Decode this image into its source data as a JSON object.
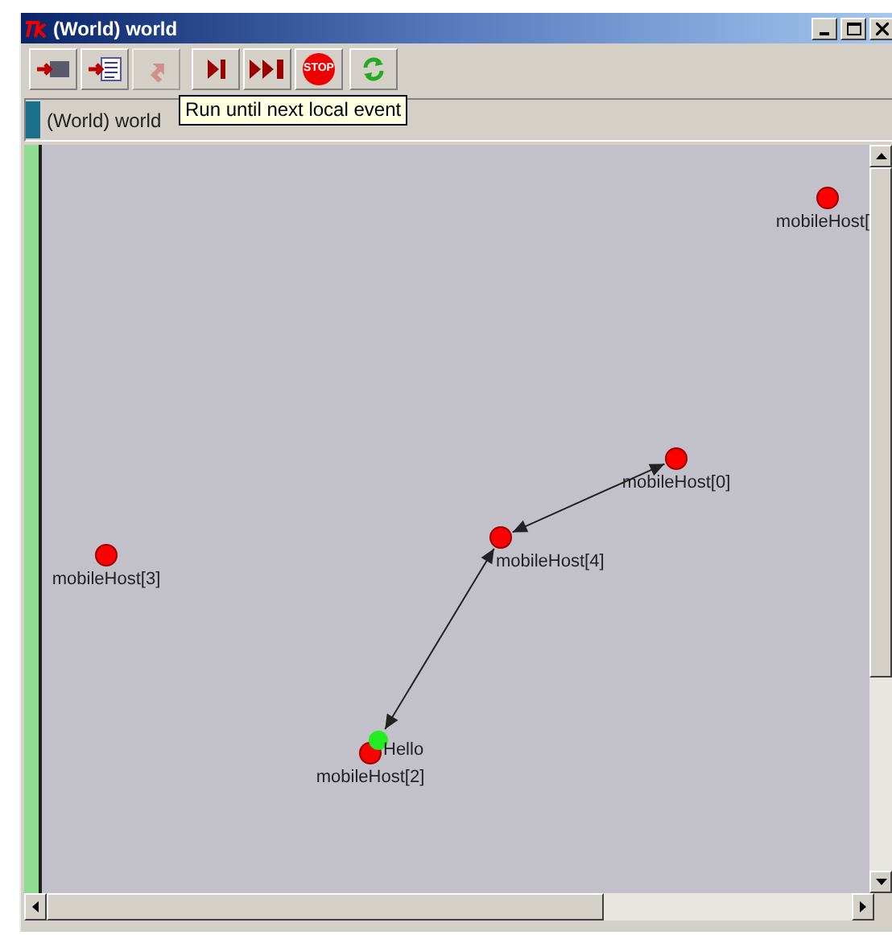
{
  "window": {
    "title": "(World) world"
  },
  "toolbar": [
    {
      "kind": "step-into",
      "disabled": false
    },
    {
      "kind": "step-list",
      "disabled": false
    },
    {
      "kind": "up",
      "disabled": true
    },
    {
      "kind": "step",
      "disabled": false
    },
    {
      "kind": "run",
      "disabled": false
    },
    {
      "kind": "stop",
      "label": "STOP",
      "disabled": false
    },
    {
      "kind": "refresh",
      "disabled": false
    }
  ],
  "tooltip": "Run until next local event",
  "info_bar": {
    "text": "(World) world"
  },
  "hosts": [
    {
      "label": "mobileHost["
    },
    {
      "label": "mobileHost[0]"
    },
    {
      "label": "mobileHost[4]"
    },
    {
      "label": "mobileHost[3]"
    },
    {
      "label": "mobileHost[2]",
      "message": "Hello"
    }
  ]
}
